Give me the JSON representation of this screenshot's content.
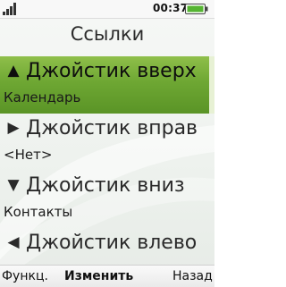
{
  "status": {
    "time": "00:37"
  },
  "title": "Ссылки",
  "items": [
    {
      "label": "Джойстик вверх",
      "value": "Календарь",
      "icon": "arrow-up",
      "glyph": "▲",
      "selected": true
    },
    {
      "label": "Джойстик вправ",
      "value": "<Нет>",
      "icon": "arrow-right",
      "glyph": "▶",
      "selected": false
    },
    {
      "label": "Джойстик вниз",
      "value": "Контакты",
      "icon": "arrow-down",
      "glyph": "▼",
      "selected": false
    },
    {
      "label": "Джойстик влево",
      "value": "",
      "icon": "arrow-left",
      "glyph": "◀",
      "selected": false
    }
  ],
  "softkeys": {
    "left": "Функц.",
    "center": "Изменить",
    "right": "Назад"
  },
  "colors": {
    "selection": "#6ea733",
    "text": "#2a2a2a"
  }
}
